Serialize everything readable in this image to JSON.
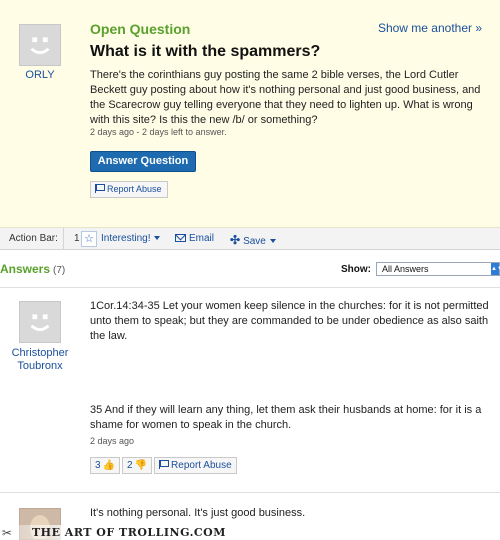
{
  "question": {
    "label": "Open Question",
    "show_another": "Show me another »",
    "user": "ORLY",
    "title": "What is it with the spammers?",
    "body": "There's the corinthians guy posting the same 2 bible verses, the Lord Cutler Beckett guy posting about how it's nothing personal and just good business, and the Scarecrow guy telling everyone that they need to lighten up. What is wrong with this site? Is this the new /b/ or something?",
    "meta": "2 days ago - 2 days left to answer.",
    "answer_button": "Answer Question",
    "report_abuse": "Report Abuse"
  },
  "action_bar": {
    "label": "Action Bar:",
    "interesting_count": "1",
    "interesting": "Interesting!",
    "email": "Email",
    "save": "Save"
  },
  "answers": {
    "heading": "Answers",
    "count": "(7)",
    "show_label": "Show:",
    "show_value": "All Answers",
    "items": [
      {
        "user": "Christopher Toubronx",
        "body_part1": "1Cor.14:34-35 Let your women keep silence in the churches: for it is not permitted unto them to speak; but they are commanded to be under obedience as also saith the law.",
        "body_part2": "35 And if they will learn any thing, let them ask their husbands at home: for it is a shame for women to speak in the church.",
        "meta": "2 days ago",
        "thumbs_up": "3",
        "thumbs_down": "2",
        "report_abuse": "Report Abuse"
      },
      {
        "body": "It's nothing personal. It's just good business."
      }
    ]
  },
  "watermark": {
    "text": "THE ART OF TROLLING.COM"
  },
  "icons": {
    "avatar": "default-avatar-icon",
    "flag": "flag-icon",
    "star": "star-icon",
    "mail": "mail-icon",
    "plus": "plus-icon",
    "thumb_up": "thumbs-up-icon",
    "thumb_down": "thumbs-down-icon"
  },
  "colors": {
    "question_bg": "#fffde6",
    "accent_green": "#5aa02c",
    "link_blue": "#1a4f9c",
    "button_blue": "#1e6bb0"
  }
}
